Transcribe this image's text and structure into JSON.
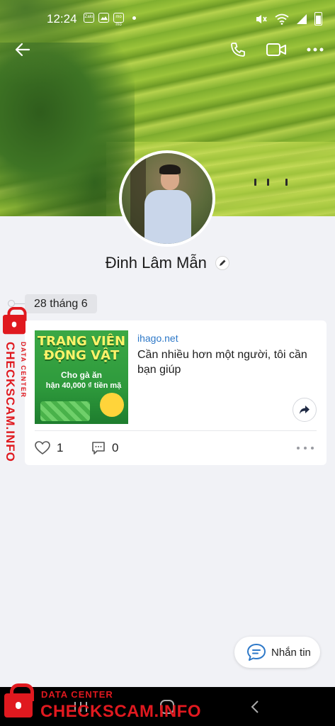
{
  "status_bar": {
    "time": "12:24",
    "notification_icons": [
      "zalo-icon",
      "gallery-icon",
      "momo-icon"
    ],
    "zalo_label": "Zalo",
    "momo_label": "mo mo",
    "system_icons": [
      "mute-icon",
      "wifi-icon",
      "signal-icon",
      "battery-icon"
    ]
  },
  "topbar": {
    "icons": [
      "back-arrow-icon",
      "phone-icon",
      "video-call-icon",
      "more-icon"
    ]
  },
  "profile": {
    "name": "Đinh Lâm Mẫn"
  },
  "timeline": {
    "date_label": "28 tháng 6"
  },
  "post": {
    "thumbnail": {
      "title": "TRANG VIÊN ĐỘNG VẬT",
      "line1": "Cho gà ăn",
      "line2": "hận 40,000 ₫ tiền mặ"
    },
    "domain": "ihago.net",
    "text": "Cần nhiều hơn một người, tôi cần bạn giúp",
    "likes": "1",
    "comments": "0"
  },
  "message_button": {
    "label": "Nhắn tin"
  },
  "nav_bar": {
    "icons": [
      "recents-icon",
      "home-icon",
      "back-icon"
    ]
  },
  "watermark": {
    "small": "DATA CENTER",
    "big": "CHECKSCAM.INFO"
  },
  "colors": {
    "accent_blue": "#2d78c8",
    "watermark_red": "#e0191f",
    "background": "#f1f2f6"
  }
}
